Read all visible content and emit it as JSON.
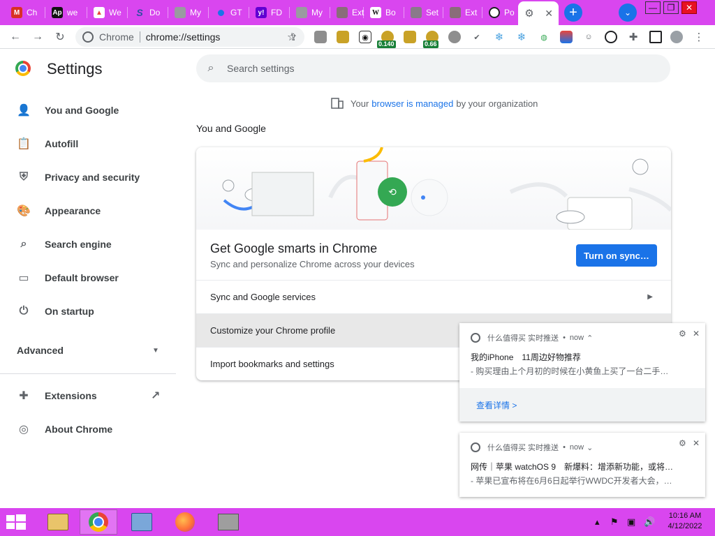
{
  "tabs": [
    {
      "label": "Ch",
      "icon": "gmail-favicon",
      "color": "#d93025"
    },
    {
      "label": "we",
      "icon": "ap-favicon",
      "color": "#111111"
    },
    {
      "label": "We",
      "icon": "rocket-favicon",
      "color": "#e8453c"
    },
    {
      "label": "Do",
      "icon": "s-favicon",
      "color": "#2d4fa3"
    },
    {
      "label": "My",
      "icon": "page-favicon",
      "color": "#9a9aa0"
    },
    {
      "label": "GT",
      "icon": "blue-dot-favicon",
      "color": "#1a73e8"
    },
    {
      "label": "FD",
      "icon": "yahoo-favicon",
      "color": "#6001d2"
    },
    {
      "label": "My",
      "icon": "page-favicon",
      "color": "#9a9aa0"
    },
    {
      "label": "Ext",
      "icon": "puzzle-favicon",
      "color": "#8a6d7a"
    },
    {
      "label": "Bo",
      "icon": "wikipedia-favicon",
      "color": "#ffffff"
    },
    {
      "label": "Set",
      "icon": "gear-favicon",
      "color": "#8a7a8a"
    },
    {
      "label": "Ext",
      "icon": "puzzle-favicon",
      "color": "#8a6d7a"
    },
    {
      "label": "Po",
      "icon": "globe-favicon",
      "color": "#202124"
    }
  ],
  "active_tab": {
    "label": "Settings",
    "icon": "gear-icon"
  },
  "window": {
    "minimize": "—",
    "maximize": "❐",
    "close": "✕"
  },
  "omnibox": {
    "chip": "Chrome",
    "url": "chrome://settings"
  },
  "extensions": [
    {
      "name": "ext-1",
      "badge": ""
    },
    {
      "name": "ext-2",
      "badge": ""
    },
    {
      "name": "ext-3",
      "badge": ""
    },
    {
      "name": "ext-4",
      "badge": "0.140"
    },
    {
      "name": "ext-5",
      "badge": ""
    },
    {
      "name": "ext-6",
      "badge": "0.66"
    }
  ],
  "settings": {
    "title": "Settings",
    "search_placeholder": "Search settings",
    "managed": {
      "before": "Your",
      "link": "browser is managed",
      "after": "by your organization"
    },
    "nav": [
      {
        "label": "You and Google",
        "icon": "person-icon"
      },
      {
        "label": "Autofill",
        "icon": "clipboard-icon"
      },
      {
        "label": "Privacy and security",
        "icon": "shield-icon"
      },
      {
        "label": "Appearance",
        "icon": "palette-icon"
      },
      {
        "label": "Search engine",
        "icon": "search-icon"
      },
      {
        "label": "Default browser",
        "icon": "browser-icon"
      },
      {
        "label": "On startup",
        "icon": "power-icon"
      }
    ],
    "advanced": "Advanced",
    "extensions": "Extensions",
    "about": "About Chrome"
  },
  "section": {
    "title": "You and Google",
    "card_title": "Get Google smarts in Chrome",
    "card_sub": "Sync and personalize Chrome across your devices",
    "sync_button": "Turn on sync…",
    "rows": [
      "Sync and Google services",
      "Customize your Chrome profile",
      "Import bookmarks and settings"
    ]
  },
  "notifications": [
    {
      "source": "什么值得买 实时推送",
      "time": "now",
      "line1": "我的iPhone　11周边好物推荐",
      "line2": "- 购买理由上个月初的时候在小黄鱼上买了一台二手…",
      "action": "查看详情 >"
    },
    {
      "source": "什么值得买 实时推送",
      "time": "now",
      "line1": "网传｜苹果 watchOS 9　新爆料：增添新功能，或将…",
      "line2": "- 苹果已宣布将在6月6日起举行WWDC开发者大会，…"
    }
  ],
  "taskbar": {
    "time": "10:16 AM",
    "date": "4/12/2022"
  },
  "colors": {
    "accent": "#1a73e8",
    "frame": "#d946ef"
  }
}
